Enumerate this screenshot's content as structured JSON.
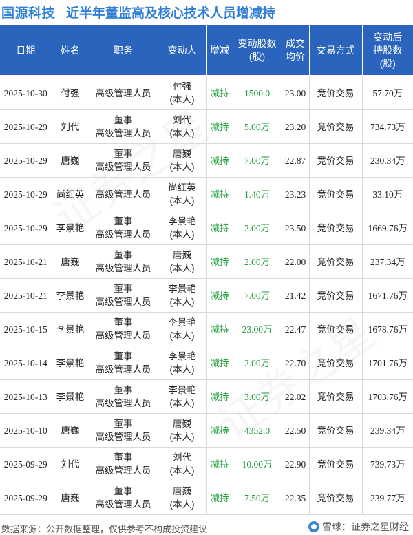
{
  "header": {
    "company": "国源科技",
    "title": "近半年董监高及核心技术人员增减持"
  },
  "table": {
    "columns": [
      {
        "lines": [
          "日期"
        ]
      },
      {
        "lines": [
          "姓名"
        ]
      },
      {
        "lines": [
          "职务"
        ]
      },
      {
        "lines": [
          "变动人"
        ]
      },
      {
        "lines": [
          "增减"
        ]
      },
      {
        "lines": [
          "变动股数",
          "(股)"
        ]
      },
      {
        "lines": [
          "成交",
          "均价"
        ]
      },
      {
        "lines": [
          "交易方式"
        ]
      },
      {
        "lines": [
          "变动后",
          "持股数",
          "(股)"
        ]
      }
    ],
    "rows": [
      {
        "date": "2025-10-30",
        "name": "付强",
        "position": [
          "高级管理人员"
        ],
        "changer": [
          "付强",
          "(本人)"
        ],
        "direction": "减持",
        "shares": "1500.0",
        "price": "23.00",
        "method": "竞价交易",
        "holding": "57.70万"
      },
      {
        "date": "2025-10-29",
        "name": "刘代",
        "position": [
          "董事",
          "高级管理人员"
        ],
        "changer": [
          "刘代",
          "(本人)"
        ],
        "direction": "减持",
        "shares": "5.00万",
        "price": "23.20",
        "method": "竞价交易",
        "holding": "734.73万"
      },
      {
        "date": "2025-10-29",
        "name": "唐巍",
        "position": [
          "董事",
          "高级管理人员"
        ],
        "changer": [
          "唐巍",
          "(本人)"
        ],
        "direction": "减持",
        "shares": "7.00万",
        "price": "22.87",
        "method": "竞价交易",
        "holding": "230.34万"
      },
      {
        "date": "2025-10-29",
        "name": "尚红英",
        "position": [
          "高级管理人员"
        ],
        "changer": [
          "尚红英",
          "(本人)"
        ],
        "direction": "减持",
        "shares": "1.40万",
        "price": "23.23",
        "method": "竞价交易",
        "holding": "33.10万"
      },
      {
        "date": "2025-10-29",
        "name": "李景艳",
        "position": [
          "董事",
          "高级管理人员"
        ],
        "changer": [
          "李景艳",
          "(本人)"
        ],
        "direction": "减持",
        "shares": "2.00万",
        "price": "23.50",
        "method": "竞价交易",
        "holding": "1669.76万"
      },
      {
        "date": "2025-10-21",
        "name": "唐巍",
        "position": [
          "董事",
          "高级管理人员"
        ],
        "changer": [
          "唐巍",
          "(本人)"
        ],
        "direction": "减持",
        "shares": "2.00万",
        "price": "22.00",
        "method": "竞价交易",
        "holding": "237.34万"
      },
      {
        "date": "2025-10-21",
        "name": "李景艳",
        "position": [
          "董事",
          "高级管理人员"
        ],
        "changer": [
          "李景艳",
          "(本人)"
        ],
        "direction": "减持",
        "shares": "7.00万",
        "price": "21.42",
        "method": "竞价交易",
        "holding": "1671.76万"
      },
      {
        "date": "2025-10-15",
        "name": "李景艳",
        "position": [
          "董事",
          "高级管理人员"
        ],
        "changer": [
          "李景艳",
          "(本人)"
        ],
        "direction": "减持",
        "shares": "23.00万",
        "price": "22.47",
        "method": "竞价交易",
        "holding": "1678.76万"
      },
      {
        "date": "2025-10-14",
        "name": "李景艳",
        "position": [
          "董事",
          "高级管理人员"
        ],
        "changer": [
          "李景艳",
          "(本人)"
        ],
        "direction": "减持",
        "shares": "2.00万",
        "price": "22.70",
        "method": "竞价交易",
        "holding": "1701.76万"
      },
      {
        "date": "2025-10-13",
        "name": "李景艳",
        "position": [
          "董事",
          "高级管理人员"
        ],
        "changer": [
          "李景艳",
          "(本人)"
        ],
        "direction": "减持",
        "shares": "3.00万",
        "price": "22.02",
        "method": "竞价交易",
        "holding": "1703.76万"
      },
      {
        "date": "2025-10-10",
        "name": "唐巍",
        "position": [
          "董事",
          "高级管理人员"
        ],
        "changer": [
          "唐巍",
          "(本人)"
        ],
        "direction": "减持",
        "shares": "4352.0",
        "price": "22.50",
        "method": "竞价交易",
        "holding": "239.34万"
      },
      {
        "date": "2025-09-29",
        "name": "刘代",
        "position": [
          "董事",
          "高级管理人员"
        ],
        "changer": [
          "刘代",
          "(本人)"
        ],
        "direction": "减持",
        "shares": "10.00万",
        "price": "22.90",
        "method": "竞价交易",
        "holding": "739.73万"
      },
      {
        "date": "2025-09-29",
        "name": "唐巍",
        "position": [
          "董事",
          "高级管理人员"
        ],
        "changer": [
          "唐巍",
          "(本人)"
        ],
        "direction": "减持",
        "shares": "7.50万",
        "price": "22.35",
        "method": "竞价交易",
        "holding": "239.77万"
      }
    ]
  },
  "footer": {
    "source": "数据来源：公开数据整理，仅供参考不构成投资建议",
    "brand": "雪球：证券之星财经",
    "brand_icon": "snowball-icon"
  },
  "watermark": "证券之星",
  "colors": {
    "title": "#2f7fd6",
    "header_bg": "#2a64bd",
    "decrease": "#1f9e3a"
  }
}
